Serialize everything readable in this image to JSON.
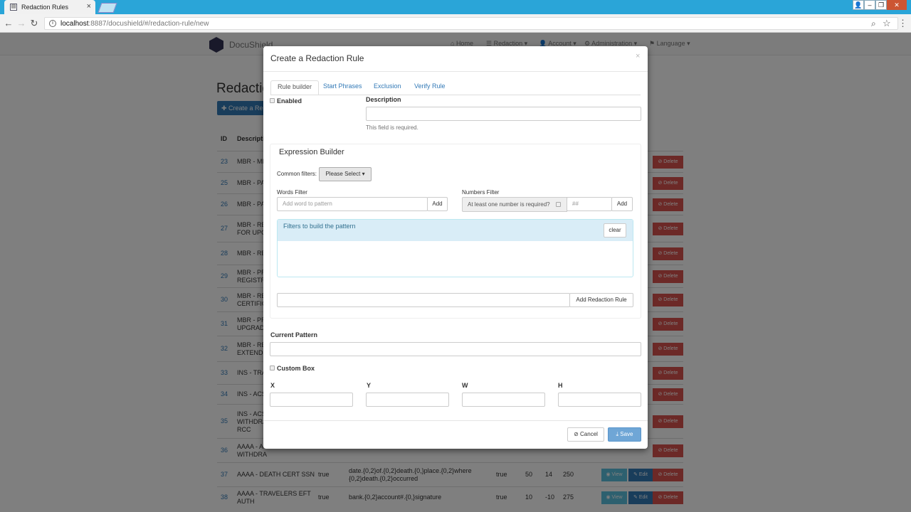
{
  "browser": {
    "tab_title": "Redaction Rules",
    "tab_close": "×",
    "url_host": "localhost",
    "url_path": ":8887/docushield/#/redaction-rule/new"
  },
  "app": {
    "brand": "DocuShield",
    "nav": [
      "Home",
      "Redaction",
      "Account",
      "Administration",
      "Language"
    ],
    "page_title": "Redaction",
    "create_button": "✚ Create a Re",
    "col_id": "ID",
    "col_desc": "Descripti",
    "btn_view": "View",
    "btn_edit": "Edit",
    "btn_delete": "Delete",
    "rows": [
      {
        "id": "23",
        "desc": "MBR - ME"
      },
      {
        "id": "25",
        "desc": "MBR - PA"
      },
      {
        "id": "26",
        "desc": "MBR - PA"
      },
      {
        "id": "27",
        "desc": "MBR - RE",
        "desc2": "FOR UPG"
      },
      {
        "id": "28",
        "desc": "MBR - RE"
      },
      {
        "id": "29",
        "desc": "MBR - PR",
        "desc2": "REGISTR"
      },
      {
        "id": "30",
        "desc": "MBR - RE",
        "desc2": "CERTIFIC"
      },
      {
        "id": "31",
        "desc": "MBR - PR",
        "desc2": "UPGRADI"
      },
      {
        "id": "32",
        "desc": "MBR - RE",
        "desc2": "EXTEND"
      },
      {
        "id": "33",
        "desc": "INS - TRA"
      },
      {
        "id": "34",
        "desc": "INS - ACS"
      },
      {
        "id": "35",
        "desc": "INS - ACS",
        "desc2": "WITHDRA",
        "desc3": "RCC"
      },
      {
        "id": "36",
        "desc": "AAAA - A",
        "desc2": "WITHDRA"
      },
      {
        "id": "37",
        "desc": "AAAA - DEATH CERT SSN",
        "enabled": "true",
        "pattern": "date.{0,2}of.{0,2}death.{0,}place.{0,2}where",
        "pattern2": "{0,2}death.{0,2}occurred",
        "en2": "true",
        "x": "50",
        "y": "14",
        "w": "250"
      },
      {
        "id": "38",
        "desc": "AAAA - TRAVELERS EFT",
        "desc2": "AUTH",
        "enabled": "true",
        "pattern": "bank.{0,2}account#.{0,}signature",
        "en2": "true",
        "x": "10",
        "y": "-10",
        "w": "275"
      }
    ]
  },
  "modal": {
    "title": "Create a Redaction Rule",
    "close": "×",
    "tabs": [
      "Rule builder",
      "Start Phrases",
      "Exclusion",
      "Verify Rule"
    ],
    "enabled_label": "Enabled",
    "description_label": "Description",
    "description_value": "",
    "description_help": "This field is required.",
    "expression_builder": "Expression Builder",
    "common_filters_label": "Common filters:",
    "common_filters_value": "Please Select",
    "words_filter_label": "Words Filter",
    "words_placeholder": "Add word to pattern",
    "add": "Add",
    "numbers_filter_label": "Numbers Filter",
    "numbers_required": "At least one number is required?",
    "numbers_placeholder": "##",
    "filters_title": "Filters to build the pattern",
    "clear": "clear",
    "add_rule": "Add Redaction Rule",
    "current_pattern_label": "Current Pattern",
    "custom_box_label": "Custom Box",
    "x_label": "X",
    "y_label": "Y",
    "w_label": "W",
    "h_label": "H",
    "cancel": "Cancel",
    "save": "Save"
  }
}
